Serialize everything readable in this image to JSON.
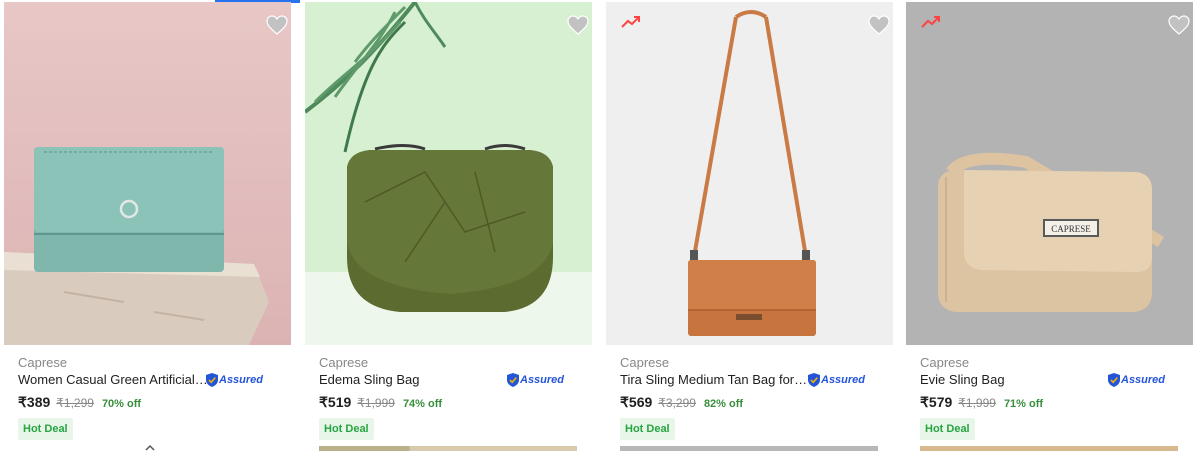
{
  "colors": {
    "accent_bar": "#2874f0",
    "offer_green": "#388e3c",
    "assured_blue": "#2455d8",
    "heart_grey": "#c2c2c2",
    "trend_red": "#ff4343"
  },
  "products": [
    {
      "brand": "Caprese",
      "title": "Women Casual Green Artificial L...",
      "assured": "Assured",
      "price": "₹389",
      "mrp": "₹1,299",
      "discount": "70% off",
      "badge": "Hot Deal",
      "trending": false
    },
    {
      "brand": "Caprese",
      "title": "Edema Sling Bag",
      "assured": "Assured",
      "price": "₹519",
      "mrp": "₹1,999",
      "discount": "74% off",
      "badge": "Hot Deal",
      "trending": false
    },
    {
      "brand": "Caprese",
      "title": "Tira Sling Medium Tan Bag for W...",
      "assured": "Assured",
      "price": "₹569",
      "mrp": "₹3,299",
      "discount": "82% off",
      "badge": "Hot Deal",
      "trending": true
    },
    {
      "brand": "Caprese",
      "title": "Evie Sling Bag",
      "assured": "Assured",
      "price": "₹579",
      "mrp": "₹1,999",
      "discount": "71% off",
      "badge": "Hot Deal",
      "trending": true
    }
  ],
  "logo_text": "CAPRESE"
}
